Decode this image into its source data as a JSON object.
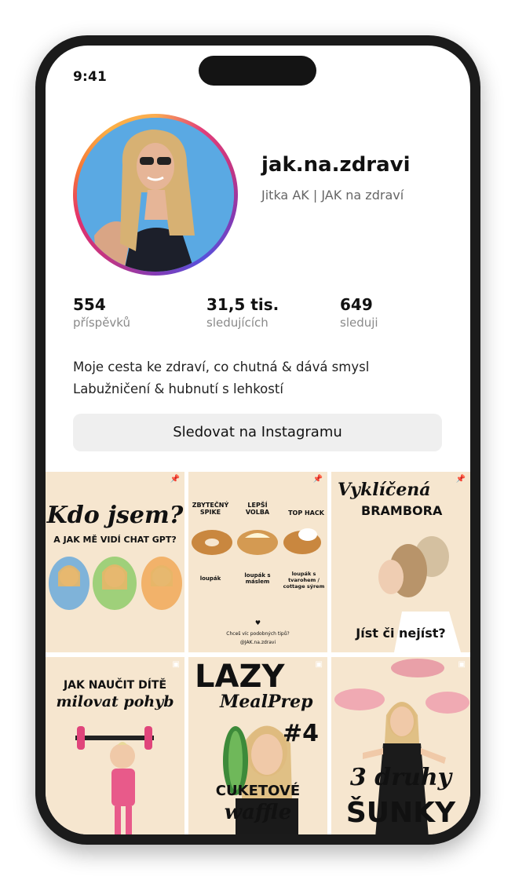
{
  "status_bar": {
    "time": "9:41"
  },
  "profile": {
    "username": "jak.na.zdravi",
    "full_name": "Jitka AK | JAK na zdraví",
    "stats": [
      {
        "value": "554",
        "label": "příspěvků"
      },
      {
        "value": "31,5 tis.",
        "label": "sledujících"
      },
      {
        "value": "649",
        "label": "sleduji"
      }
    ],
    "bio_line1": "Moje cesta ke zdraví, co chutná & dává smysl",
    "bio_line2": "Labužničení & hubnutí s lehkostí",
    "follow_button": "Sledovat na Instagramu"
  },
  "posts": [
    {
      "title_line1": "Kdo jsem?",
      "title_line2": "A JAK MĚ VIDÍ CHAT GPT?"
    },
    {
      "col1_title": "ZBYTEČNÝ SPIKE",
      "col2_title": "LEPŠÍ VOLBA",
      "col3_title": "TOP HACK",
      "col1_item": "loupák",
      "col2_item": "loupák s máslem",
      "col3_item": "loupák s tvarohem / cottage sýrem",
      "footer": "Chceš víc podobných tipů?",
      "handle": "@JAK.na.zdravi"
    },
    {
      "title_line1": "Vyklíčená",
      "title_line2": "BRAMBORA",
      "caption": "Jíst či nejíst?"
    },
    {
      "title_line1": "JAK NAUČIT DÍTĚ",
      "title_line2": "milovat pohyb"
    },
    {
      "title_line1": "LAZY",
      "title_line2": "MealPrep",
      "number": "#4",
      "caption1": "CUKETOVÉ",
      "caption2": "waffle"
    },
    {
      "title_line1": "3 druhy",
      "title_line2": "ŠUNKY"
    }
  ],
  "colors": {
    "tile_bg": "#f6e6cf",
    "button_bg": "#efefef",
    "ring_start": "#fbad50",
    "ring_end": "#833ab4"
  }
}
